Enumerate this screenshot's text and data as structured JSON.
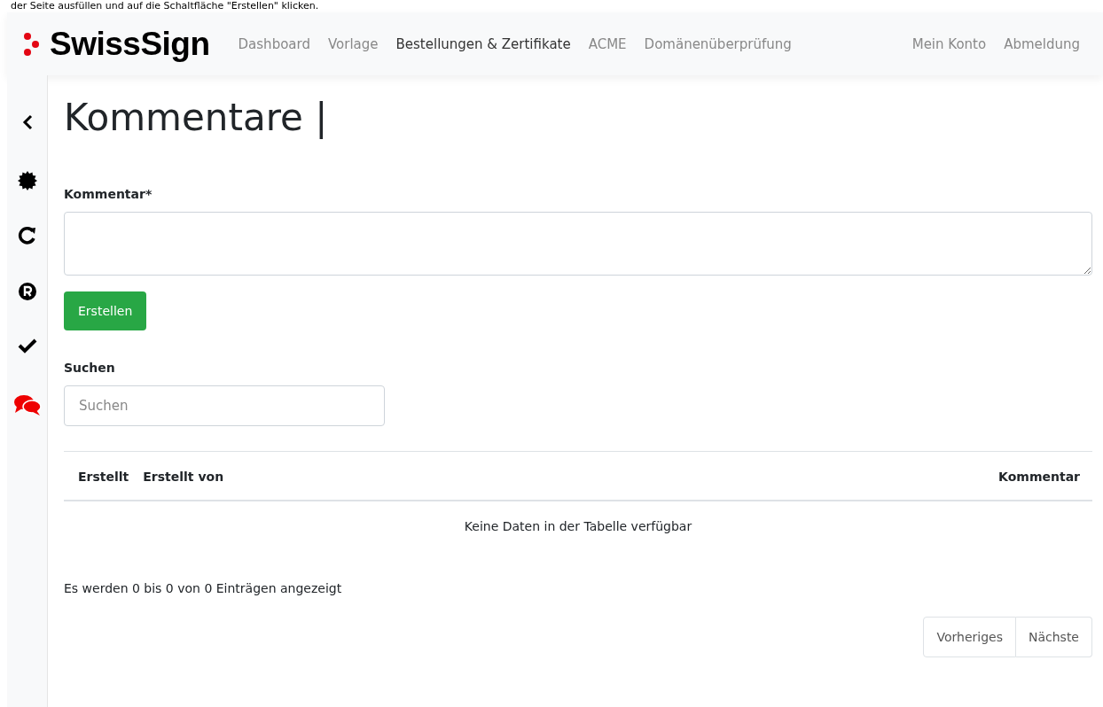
{
  "caption": "der Seite ausfüllen und auf die Schaltfläche \"Erstellen\" klicken.",
  "navbar": {
    "brand": "SwissSign",
    "links": [
      {
        "label": "Dashboard",
        "selected": false
      },
      {
        "label": "Vorlage",
        "selected": false
      },
      {
        "label": "Bestellungen & Zertifikate",
        "selected": true
      },
      {
        "label": "ACME",
        "selected": false
      },
      {
        "label": "Domänenüberprüfung",
        "selected": false
      }
    ],
    "account_links": [
      "Mein Konto",
      "Abmeldung"
    ]
  },
  "sidebar": {
    "items": [
      {
        "kind": "back",
        "selected": false
      },
      {
        "kind": "badge",
        "selected": false
      },
      {
        "kind": "renew",
        "selected": false
      },
      {
        "kind": "registered",
        "selected": false
      },
      {
        "kind": "check",
        "selected": false
      },
      {
        "kind": "comments",
        "selected": true
      }
    ]
  },
  "page_title": "Kommentare |",
  "form": {
    "label": "Kommentar*",
    "button": "Erstellen"
  },
  "search": {
    "label": "Suchen",
    "placeholder": "Suchen"
  },
  "table": {
    "columns": [
      "Erstellt",
      "Erstellt von",
      "Kommentar"
    ],
    "empty_message": "Keine Daten in der Tabelle verfügbar"
  },
  "info": "Es werden 0 bis 0 von 0 Einträgen angezeigt",
  "pagination": [
    "Vorheriges",
    "Nächste"
  ]
}
